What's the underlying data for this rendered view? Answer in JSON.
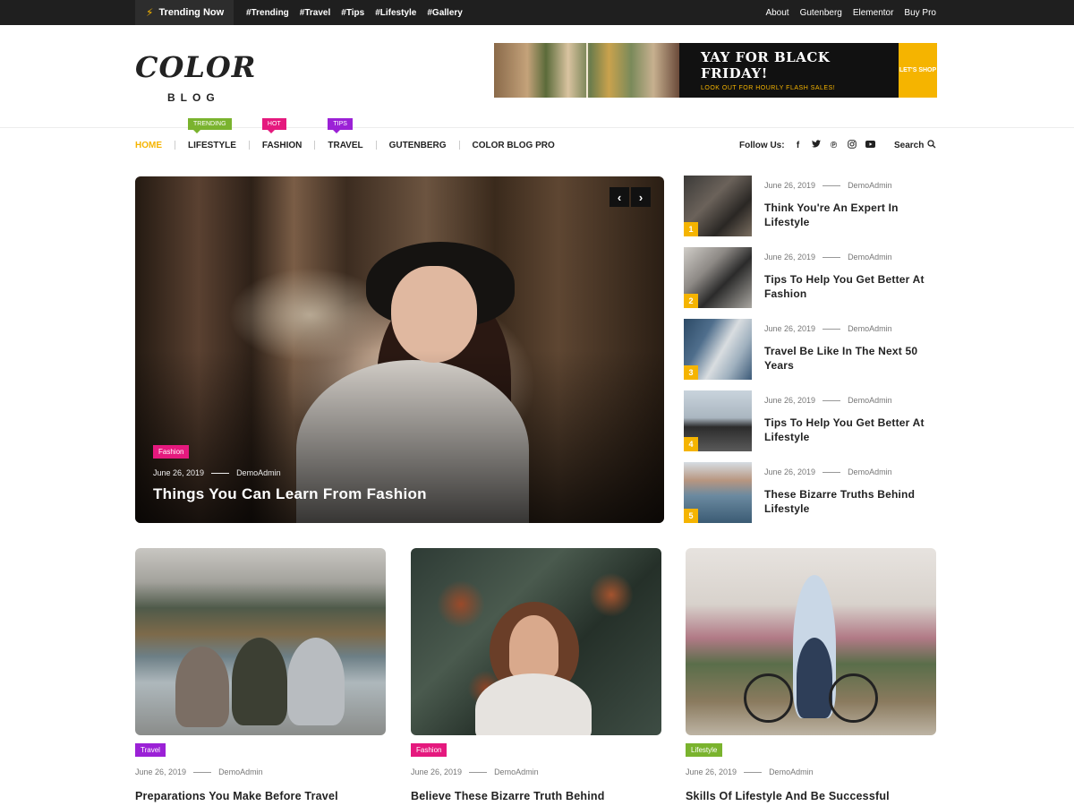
{
  "topbar": {
    "trending_label": "Trending Now",
    "tags": [
      "#Trending",
      "#Travel",
      "#Tips",
      "#Lifestyle",
      "#Gallery"
    ],
    "links": [
      "About",
      "Gutenberg",
      "Elementor",
      "Buy Pro"
    ]
  },
  "logo": {
    "word1": "COLOR",
    "word2": "BLOG"
  },
  "banner": {
    "title": "YAY FOR BLACK FRIDAY!",
    "subtitle": "LOOK OUT FOR HOURLY FLASH SALES!",
    "cta": "LET'S SHOP"
  },
  "nav": {
    "items": [
      {
        "label": "HOME",
        "active": true,
        "badge": ""
      },
      {
        "label": "LIFESTYLE",
        "badge": "TRENDING",
        "badge_color": "#7ab32e"
      },
      {
        "label": "FASHION",
        "badge": "HOT",
        "badge_color": "#e5197e"
      },
      {
        "label": "TRAVEL",
        "badge": "TIPS",
        "badge_color": "#9b21d6"
      },
      {
        "label": "GUTENBERG",
        "badge": ""
      },
      {
        "label": "COLOR BLOG PRO",
        "badge": ""
      }
    ],
    "follow_label": "Follow Us:",
    "social_icons": [
      "facebook-icon",
      "twitter-icon",
      "pinterest-icon",
      "instagram-icon",
      "youtube-icon"
    ],
    "search_label": "Search"
  },
  "hero": {
    "tag": "Fashion",
    "tag_color": "#e5197e",
    "date": "June 26, 2019",
    "author": "DemoAdmin",
    "title": "Things You Can Learn From Fashion"
  },
  "side_posts": [
    {
      "num": "1",
      "date": "June 26, 2019",
      "author": "DemoAdmin",
      "title": "Think You're An Expert In Lifestyle"
    },
    {
      "num": "2",
      "date": "June 26, 2019",
      "author": "DemoAdmin",
      "title": "Tips To Help You Get Better At Fashion"
    },
    {
      "num": "3",
      "date": "June 26, 2019",
      "author": "DemoAdmin",
      "title": "Travel Be Like In The Next 50 Years"
    },
    {
      "num": "4",
      "date": "June 26, 2019",
      "author": "DemoAdmin",
      "title": "Tips To Help You Get Better At Lifestyle"
    },
    {
      "num": "5",
      "date": "June 26, 2019",
      "author": "DemoAdmin",
      "title": "These Bizarre Truths Behind Lifestyle"
    }
  ],
  "cards": [
    {
      "tag": "Travel",
      "tag_color": "#9b21d6",
      "date": "June 26, 2019",
      "author": "DemoAdmin",
      "title": "Preparations You Make Before Travel"
    },
    {
      "tag": "Fashion",
      "tag_color": "#e5197e",
      "date": "June 26, 2019",
      "author": "DemoAdmin",
      "title": "Believe These Bizarre Truth Behind"
    },
    {
      "tag": "Lifestyle",
      "tag_color": "#7ab32e",
      "date": "June 26, 2019",
      "author": "DemoAdmin",
      "title": "Skills Of Lifestyle And Be Successful"
    }
  ],
  "colors": {
    "accent": "#f5b400",
    "topbar": "#1f1f1f"
  }
}
